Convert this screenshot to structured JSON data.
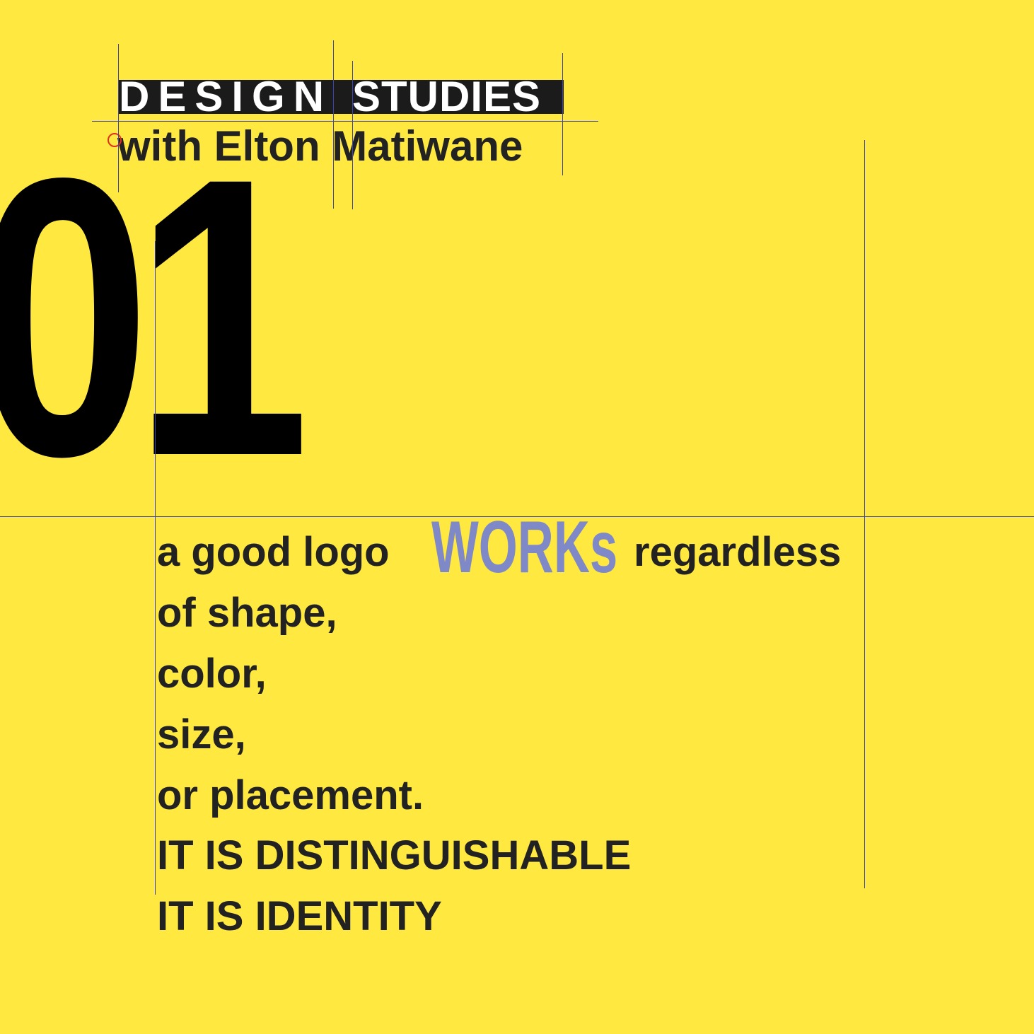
{
  "header": {
    "title_word_1": "DESIGN",
    "title_word_2": "STUDIES",
    "subtitle": "with Elton Matiwane"
  },
  "number": "01",
  "statement": {
    "line1_start": "a good logo",
    "highlight": "WORKs",
    "line1_end": "regardless",
    "line2": "of shape,",
    "line3": "color,",
    "line4": "size,",
    "line5": "or placement.",
    "line6": "IT IS DISTINGUISHABLE",
    "line7": "IT IS IDENTITY"
  },
  "colors": {
    "background": "#FFE940",
    "text": "#222222",
    "highlight": "#7F89C7",
    "guides": "#3A44B8",
    "number": "#000000"
  }
}
